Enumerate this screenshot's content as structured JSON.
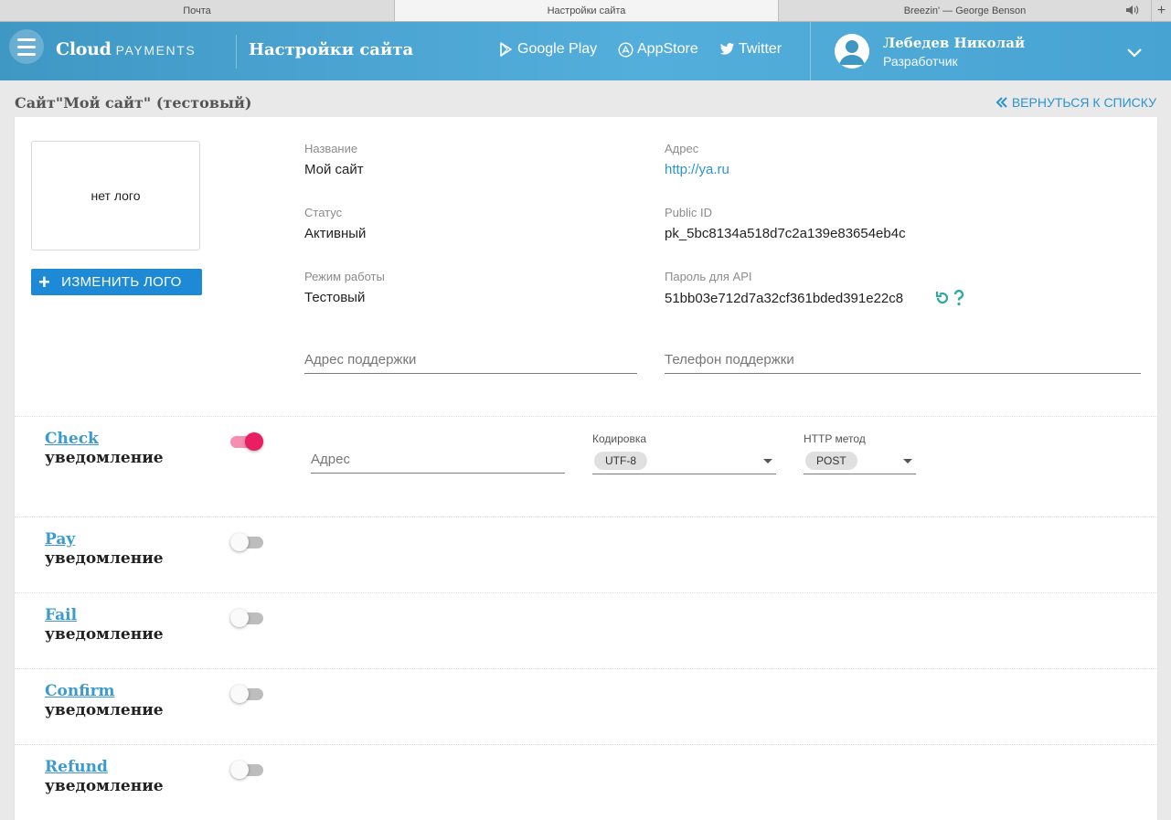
{
  "browser": {
    "tabs": [
      {
        "label": "Почта"
      },
      {
        "label": "Настройки сайта"
      },
      {
        "label": "Breezin' — George Benson"
      }
    ],
    "new_tab": "+"
  },
  "header": {
    "logo_primary": "Cloud",
    "logo_secondary": "PAYMENTS",
    "title": "Настройки сайта",
    "links": [
      {
        "label": "Google Play",
        "icon": "google-play-icon"
      },
      {
        "label": "AppStore",
        "icon": "appstore-icon"
      },
      {
        "label": "Twitter",
        "icon": "twitter-icon"
      }
    ],
    "user": {
      "name": "Лебедев Николай",
      "role": "Разработчик"
    },
    "colors": {
      "gradient_start": "#3f97c4",
      "gradient_end": "#54aedb"
    }
  },
  "site": {
    "title": "Сайт\"Мой сайт\" (тестовый)",
    "back_label": "ВЕРНУТЬСЯ К СПИСКУ",
    "logo_placeholder": "нет лого",
    "change_logo_label": "ИЗМЕНИТЬ ЛОГО",
    "fields": {
      "name": {
        "label": "Название",
        "value": "Мой сайт"
      },
      "address": {
        "label": "Адрес",
        "value": "http://ya.ru"
      },
      "status": {
        "label": "Статус",
        "value": "Активный"
      },
      "public_id": {
        "label": "Public ID",
        "value": "pk_5bc8134a518d7c2a139e83654eb4c"
      },
      "mode": {
        "label": "Режим работы",
        "value": "Тестовый"
      },
      "api_password": {
        "label": "Пароль для API",
        "value": "51bb03e712d7a32cf361bded391e22c8"
      }
    },
    "support_address_placeholder": "Адрес поддержки",
    "support_phone_placeholder": "Телефон поддержки"
  },
  "notifications": {
    "subtitle": "уведомление",
    "address_placeholder": "Адрес",
    "encoding_label": "Кодировка",
    "encoding_value": "UTF-8",
    "method_label": "HTTP метод",
    "method_value": "POST",
    "items": [
      {
        "title": "Check",
        "enabled": true
      },
      {
        "title": "Pay",
        "enabled": false
      },
      {
        "title": "Fail",
        "enabled": false
      },
      {
        "title": "Confirm",
        "enabled": false
      },
      {
        "title": "Refund",
        "enabled": false
      }
    ],
    "colors": {
      "toggle_on": "#e91e63",
      "link": "#3a9ad1"
    }
  }
}
